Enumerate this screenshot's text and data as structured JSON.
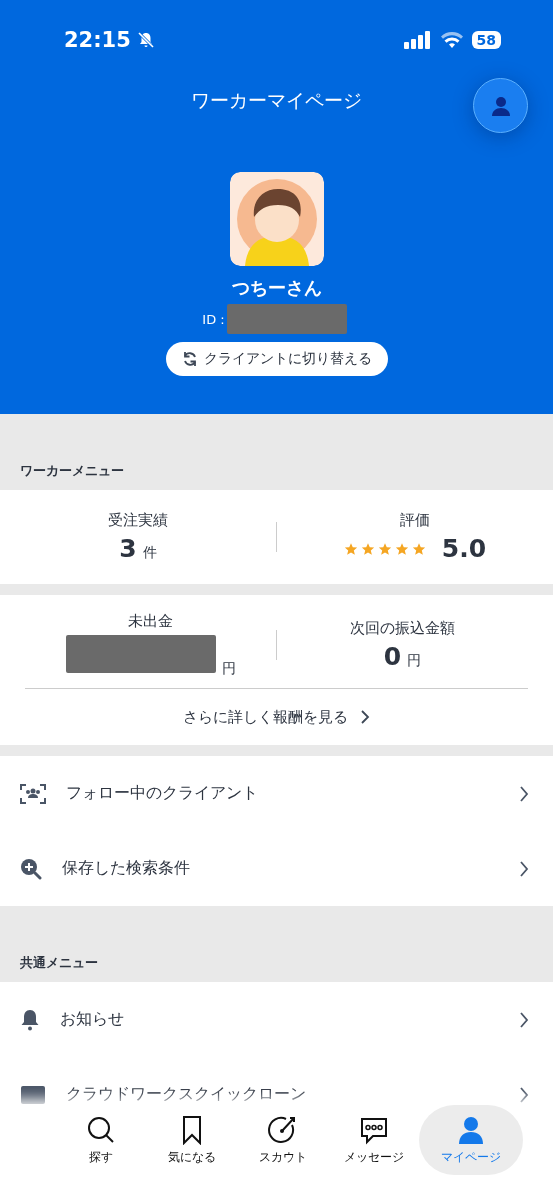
{
  "status_bar": {
    "time": "22:15",
    "battery": "58"
  },
  "header": {
    "title": "ワーカーマイページ"
  },
  "profile": {
    "name": "つちーさん",
    "id_label": "ID :",
    "switch_button": "クライアントに切り替える"
  },
  "worker_menu": {
    "heading": "ワーカーメニュー",
    "stats": [
      {
        "kind": "count",
        "label": "受注実績",
        "value": "3",
        "unit": "件"
      },
      {
        "kind": "rating",
        "label": "評価",
        "stars": 5,
        "value": "5.0"
      }
    ],
    "earnings": [
      {
        "kind": "redacted",
        "label": "未出金",
        "unit": "円"
      },
      {
        "kind": "amount",
        "label": "次回の振込金額",
        "value": "0",
        "unit": "円"
      }
    ],
    "details_link": "さらに詳しく報酬を見る",
    "items": [
      {
        "label": "フォロー中のクライアント"
      },
      {
        "label": "保存した検索条件"
      }
    ]
  },
  "common_menu": {
    "heading": "共通メニュー",
    "items": [
      {
        "label": "お知らせ"
      },
      {
        "label": "クラウドワークスクイックローン"
      }
    ]
  },
  "tab_bar": [
    {
      "label": "探す",
      "selected": false
    },
    {
      "label": "気になる",
      "selected": false
    },
    {
      "label": "スカウト",
      "selected": false
    },
    {
      "label": "メッセージ",
      "selected": false
    },
    {
      "label": "マイページ",
      "selected": true
    }
  ]
}
